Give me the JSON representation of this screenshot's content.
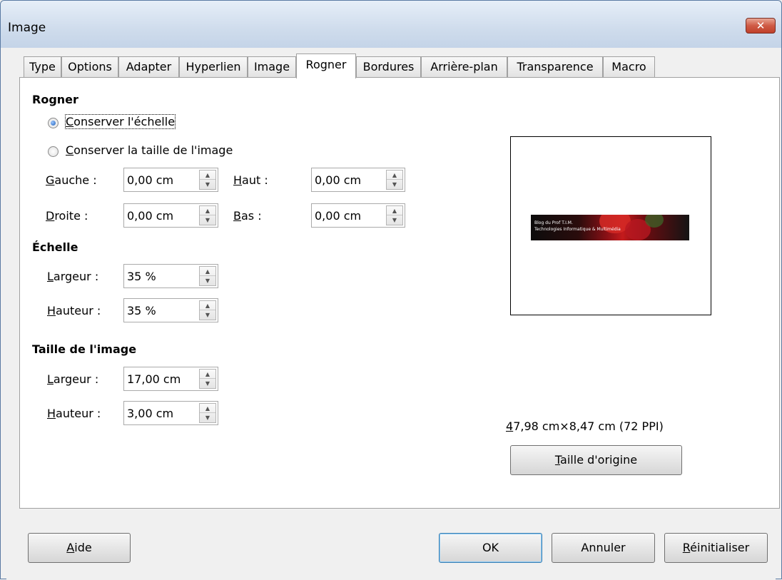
{
  "window": {
    "title": "Image",
    "close_glyph": "✕"
  },
  "tabs": [
    {
      "label": "Type"
    },
    {
      "label": "Options"
    },
    {
      "label": "Adapter"
    },
    {
      "label": "Hyperlien"
    },
    {
      "label": "Image"
    },
    {
      "label": "Rogner",
      "active": true
    },
    {
      "label": "Bordures"
    },
    {
      "label": "Arrière-plan"
    },
    {
      "label": "Transparence"
    },
    {
      "label": "Macro"
    }
  ],
  "crop": {
    "title": "Rogner",
    "keep_scale": {
      "accel": "C",
      "rest": "onserver l'échelle",
      "checked": true
    },
    "keep_size": {
      "accel": "C",
      "rest": "onserver la taille de l'image",
      "checked": false
    },
    "left": {
      "accel": "G",
      "rest": "auche :",
      "value": "0,00 cm"
    },
    "top": {
      "accel": "H",
      "rest": "aut :",
      "value": "0,00 cm"
    },
    "right": {
      "accel": "D",
      "rest": "roite :",
      "value": "0,00 cm"
    },
    "bottom": {
      "accel": "B",
      "rest": "as :",
      "value": "0,00 cm"
    }
  },
  "scale": {
    "title": "Échelle",
    "width": {
      "accel": "L",
      "rest": "argeur :",
      "value": "35 %"
    },
    "height": {
      "accel": "H",
      "rest": "auteur :",
      "value": "35 %"
    }
  },
  "image_size": {
    "title": "Taille de l'image",
    "width": {
      "accel": "L",
      "rest": "argeur :",
      "value": "17,00 cm"
    },
    "height": {
      "accel": "H",
      "rest": "auteur :",
      "value": "3,00 cm"
    }
  },
  "preview": {
    "image_line1": "Blog du Prof T.I.M.",
    "image_line2": "Technologies Informatique & Multimédia",
    "original_size": {
      "accel": "4",
      "rest": "7,98 cm×8,47 cm (72 PPI)"
    },
    "original_button": {
      "accel": "T",
      "rest": "aille d'origine"
    }
  },
  "buttons": {
    "help": {
      "accel": "A",
      "rest": "ide"
    },
    "ok": "OK",
    "cancel": "Annuler",
    "reset": {
      "accel": "R",
      "rest": "éinitialiser"
    }
  },
  "spin_glyphs": {
    "up": "▲",
    "down": "▼"
  }
}
